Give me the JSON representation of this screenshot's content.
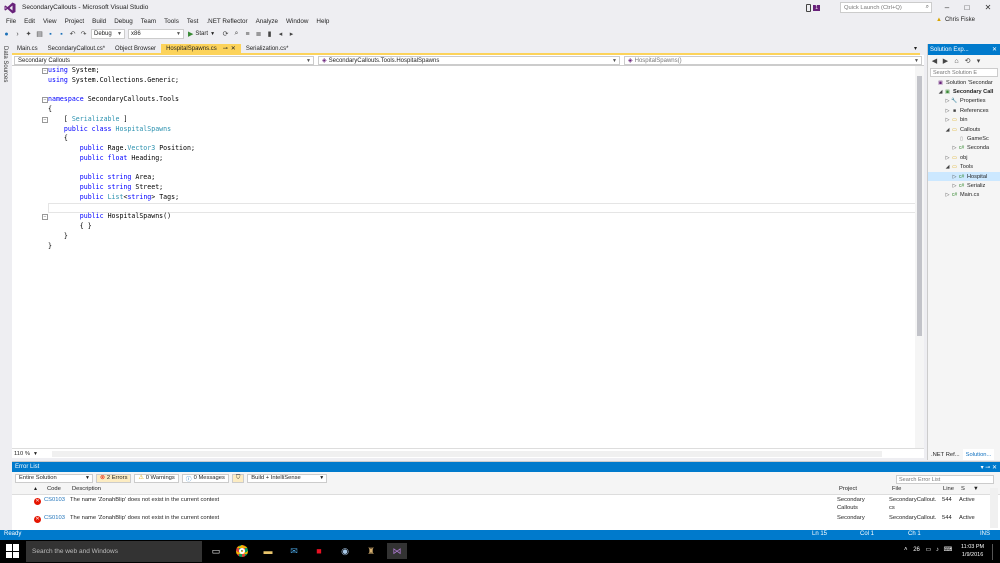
{
  "window": {
    "title": "SecondaryCallouts - Microsoft Visual Studio",
    "notification_count": "1",
    "quick_launch_placeholder": "Quick Launch (Ctrl+Q)",
    "user": "Chris Fiske"
  },
  "menu": [
    "File",
    "Edit",
    "View",
    "Project",
    "Build",
    "Debug",
    "Team",
    "Tools",
    "Test",
    ".NET Reflector",
    "Analyze",
    "Window",
    "Help"
  ],
  "toolbar": {
    "config": "Debug",
    "platform": "x86",
    "start_label": "Start"
  },
  "doc_tabs": [
    {
      "label": "Main.cs",
      "active": false
    },
    {
      "label": "SecondaryCallout.cs*",
      "active": false
    },
    {
      "label": "Object Browser",
      "active": false
    },
    {
      "label": "HospitalSpawns.cs",
      "active": true
    },
    {
      "label": "Serialization.cs*",
      "active": false
    }
  ],
  "left_strip": {
    "label": "Data Sources"
  },
  "nav": {
    "project": "Secondary Callouts",
    "type": "SecondaryCallouts.Tools.HospitalSpawns",
    "member": "HospitalSpawns()"
  },
  "code": [
    [
      [
        "kw",
        "using"
      ],
      [
        "",
        "System;"
      ]
    ],
    [
      [
        "kw",
        "using"
      ],
      [
        "",
        "System.Collections.Generic;"
      ]
    ],
    [],
    [
      [
        "kw",
        "namespace"
      ],
      [
        "",
        "SecondaryCallouts.Tools"
      ]
    ],
    [
      [
        "",
        "{"
      ]
    ],
    [
      [
        "",
        "    ["
      ],
      [
        "ty",
        "Serializable"
      ],
      [
        "",
        "]"
      ]
    ],
    [
      [
        "",
        "    "
      ],
      [
        "kw",
        "public class"
      ],
      [
        "ty",
        "HospitalSpawns"
      ]
    ],
    [
      [
        "",
        "    {"
      ]
    ],
    [
      [
        "",
        "        "
      ],
      [
        "kw",
        "public"
      ],
      [
        "",
        "Rage."
      ],
      [
        "ty",
        "Vector3"
      ],
      [
        "",
        "Position;"
      ]
    ],
    [
      [
        "",
        "        "
      ],
      [
        "kw",
        "public float"
      ],
      [
        "",
        "Heading;"
      ]
    ],
    [],
    [
      [
        "",
        "        "
      ],
      [
        "kw",
        "public string"
      ],
      [
        "",
        "Area;"
      ]
    ],
    [
      [
        "",
        "        "
      ],
      [
        "kw",
        "public string"
      ],
      [
        "",
        "Street;"
      ]
    ],
    [
      [
        "",
        "        "
      ],
      [
        "kw",
        "public"
      ],
      [
        "ty",
        "List"
      ],
      [
        "",
        "<"
      ],
      [
        "kw",
        "string"
      ],
      [
        "",
        "> Tags;"
      ]
    ],
    [],
    [
      [
        "",
        "        "
      ],
      [
        "kw",
        "public"
      ],
      [
        "",
        "HospitalSpawns()"
      ]
    ],
    [
      [
        "",
        "        { }"
      ]
    ],
    [
      [
        "",
        "    }"
      ]
    ],
    [
      [
        "",
        "}"
      ]
    ]
  ],
  "zoom": "110 %",
  "solution_explorer": {
    "title": "Solution Exp...",
    "search_placeholder": "Search Solution E",
    "items": [
      {
        "label": "Solution 'Secondar",
        "indent": 0,
        "exp": "",
        "icon": "solution-icon",
        "bold": false,
        "sel": false
      },
      {
        "label": "Secondary Call",
        "indent": 1,
        "exp": "◢",
        "icon": "csharp-project-icon",
        "bold": true,
        "sel": false
      },
      {
        "label": "Properties",
        "indent": 2,
        "exp": "▷",
        "icon": "wrench-icon",
        "bold": false,
        "sel": false
      },
      {
        "label": "References",
        "indent": 2,
        "exp": "▷",
        "icon": "references-icon",
        "bold": false,
        "sel": false
      },
      {
        "label": "bin",
        "indent": 2,
        "exp": "▷",
        "icon": "folder-icon",
        "bold": false,
        "sel": false
      },
      {
        "label": "Callouts",
        "indent": 2,
        "exp": "◢",
        "icon": "folder-icon",
        "bold": false,
        "sel": false
      },
      {
        "label": "GameSc",
        "indent": 3,
        "exp": "",
        "icon": "file-icon",
        "bold": false,
        "sel": false
      },
      {
        "label": "Seconda",
        "indent": 3,
        "exp": "▷",
        "icon": "csharp-file-icon",
        "bold": false,
        "sel": false
      },
      {
        "label": "obj",
        "indent": 2,
        "exp": "▷",
        "icon": "folder-icon",
        "bold": false,
        "sel": false
      },
      {
        "label": "Tools",
        "indent": 2,
        "exp": "◢",
        "icon": "folder-icon",
        "bold": false,
        "sel": false
      },
      {
        "label": "Hospital",
        "indent": 3,
        "exp": "▷",
        "icon": "csharp-file-icon",
        "bold": false,
        "sel": true
      },
      {
        "label": "Serializ",
        "indent": 3,
        "exp": "▷",
        "icon": "csharp-file-icon",
        "bold": false,
        "sel": false
      },
      {
        "label": "Main.cs",
        "indent": 2,
        "exp": "▷",
        "icon": "csharp-file-icon",
        "bold": false,
        "sel": false
      }
    ],
    "bottom_tabs": [
      ".NET Ref...",
      "Solution..."
    ]
  },
  "error_list": {
    "title": "Error List",
    "scope": "Entire Solution",
    "errors_btn": "2 Errors",
    "warnings_btn": "0 Warnings",
    "messages_btn": "0 Messages",
    "build_filter": "Build + IntelliSense",
    "search_placeholder": "Search Error List",
    "columns": {
      "code": "Code",
      "description": "Description",
      "project": "Project",
      "file": "File",
      "line": "Line",
      "suppression": "S"
    },
    "rows": [
      {
        "code": "CS0103",
        "description": "The name 'ZonahBlip' does not exist in the current context",
        "project": "Secondary Callouts",
        "file": "SecondaryCallout. cs",
        "line": "544",
        "state": "Active"
      },
      {
        "code": "CS0103",
        "description": "The name 'ZonahBlip' does not exist in the current context",
        "project": "Secondary",
        "file": "SecondaryCallout.",
        "line": "544",
        "state": "Active"
      }
    ]
  },
  "status": {
    "left": "Ready",
    "ln": "Ln 15",
    "col": "Col 1",
    "ch": "Ch 1",
    "mode": "INS"
  },
  "taskbar": {
    "search_placeholder": "Search the web and Windows",
    "tray_text": "26",
    "time": "11:03 PM",
    "date": "1/9/2016"
  },
  "colors": {
    "accent": "#007acc",
    "active_tab": "#fcd35b",
    "keyword": "#0000ff",
    "type": "#2b91af",
    "error": "#e51400"
  }
}
